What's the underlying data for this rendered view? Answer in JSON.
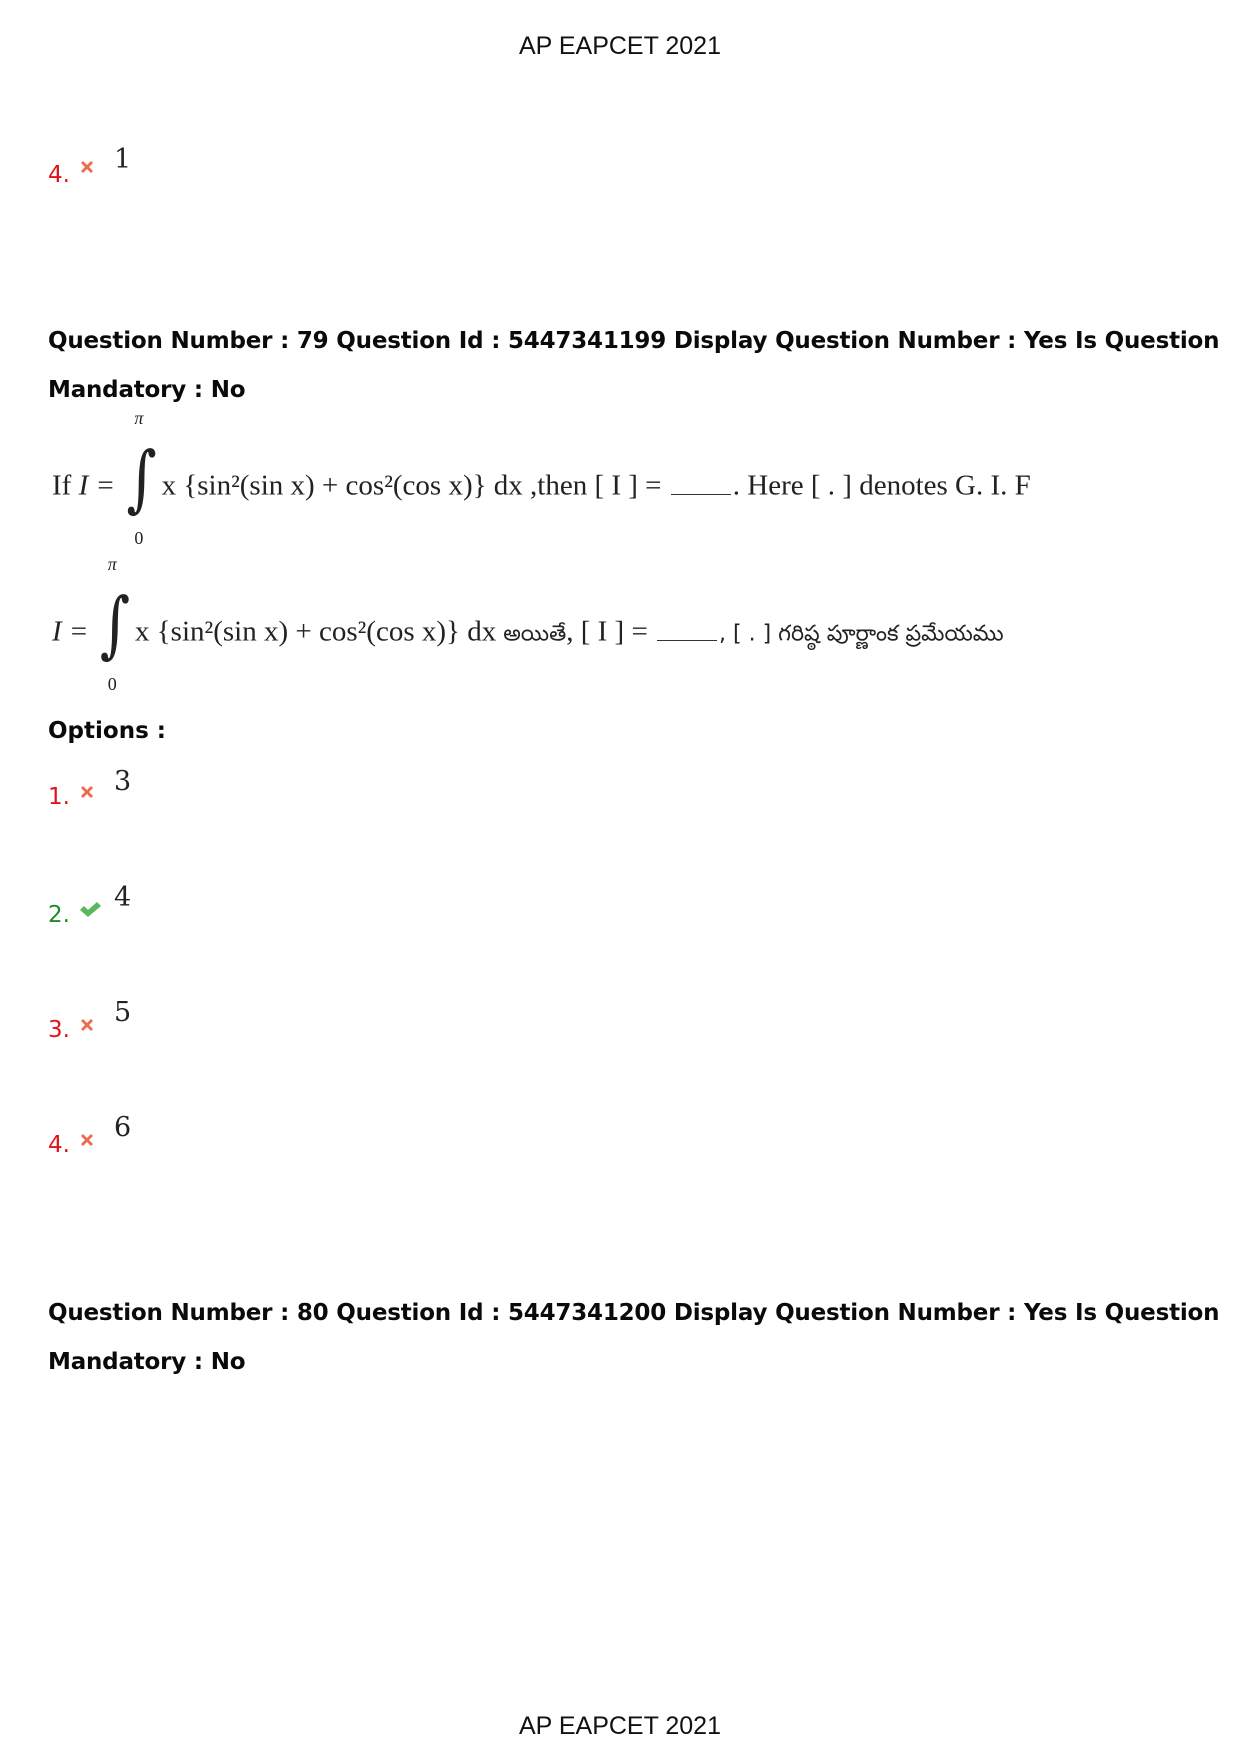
{
  "page": {
    "header": "AP EAPCET 2021",
    "footer": "AP EAPCET 2021"
  },
  "previous_question_tail": {
    "option": {
      "number": "4.",
      "status": "wrong",
      "icon": "cross-icon",
      "value": "1"
    }
  },
  "question_79": {
    "header_line1": "Question Number : 79 Question Id : 5447341199 Display Question Number : Yes Is Question",
    "header_line2": "Mandatory : No",
    "english": {
      "prefix": "If ",
      "lhs": "I =",
      "upper_limit": "π",
      "lower_limit": "0",
      "integrand": "x {sin²(sin x) + cos²(cos x)} dx",
      "middle": " ,then [ I ] = ",
      "suffix": ". Here [ . ] denotes G. I. F"
    },
    "telugu": {
      "lhs": "I =",
      "upper_limit": "π",
      "lower_limit": "0",
      "integrand": "x {sin²(sin x) + cos²(cos x)} dx",
      "word_if": " అయితే",
      "middle": ", [ I ] = ",
      "suffix": ", [ . ] గరిష్ఠ పూర్ణాంక ప్రమేయము"
    },
    "options_label": "Options :",
    "options": [
      {
        "number": "1.",
        "status": "wrong",
        "icon": "cross-icon",
        "value": "3"
      },
      {
        "number": "2.",
        "status": "correct",
        "icon": "check-icon",
        "value": "4"
      },
      {
        "number": "3.",
        "status": "wrong",
        "icon": "cross-icon",
        "value": "5"
      },
      {
        "number": "4.",
        "status": "wrong",
        "icon": "cross-icon",
        "value": "6"
      }
    ]
  },
  "question_80": {
    "header_line1": "Question Number : 80 Question Id : 5447341200 Display Question Number : Yes Is Question",
    "header_line2": "Mandatory : No"
  },
  "colors": {
    "wrong": "#e0121b",
    "correct": "#1f8a2a",
    "cross_icon": "#ee6a50",
    "check_icon": "#5cb85c"
  }
}
